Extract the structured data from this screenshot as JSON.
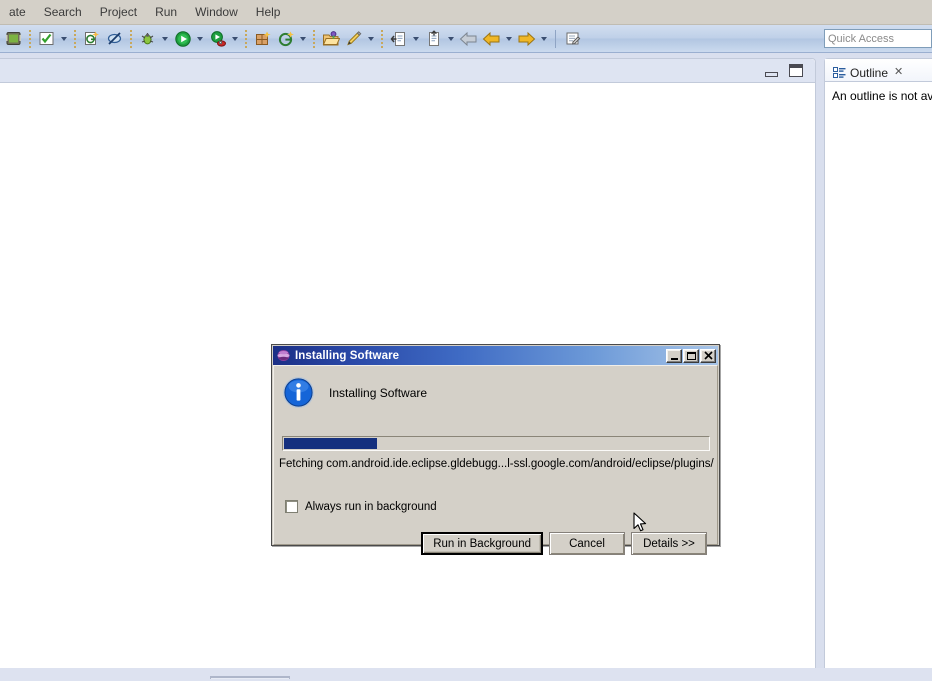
{
  "menubar": {
    "items": [
      {
        "label": "ate",
        "name": "menu-navigate"
      },
      {
        "label": "Search",
        "name": "menu-search"
      },
      {
        "label": "Project",
        "name": "menu-project"
      },
      {
        "label": "Run",
        "name": "menu-run"
      },
      {
        "label": "Window",
        "name": "menu-window"
      },
      {
        "label": "Help",
        "name": "menu-help"
      }
    ]
  },
  "toolbar": {
    "buttons": [
      {
        "name": "android-sdk-manager-icon",
        "title": "Android SDK Manager"
      },
      {
        "name": "save-check-icon",
        "title": "Save"
      },
      {
        "name": "new-java-class-icon",
        "title": "New Java Class"
      },
      {
        "name": "toggle-breakpoint-icon",
        "title": "Skip All Breakpoints"
      },
      {
        "name": "debug-icon",
        "title": "Debug"
      },
      {
        "name": "run-icon",
        "title": "Run"
      },
      {
        "name": "run-external-tools-icon",
        "title": "External Tools"
      },
      {
        "name": "new-package-icon",
        "title": "New Package"
      },
      {
        "name": "open-type-icon",
        "title": "Open Type"
      },
      {
        "name": "open-resource-icon",
        "title": "Open Resource"
      },
      {
        "name": "annotation-icon",
        "title": "Next Annotation"
      },
      {
        "name": "previous-edit-icon",
        "title": "Previous Edit Location"
      },
      {
        "name": "next-edit-icon",
        "title": "Next Edit Location"
      },
      {
        "name": "back-arrow-icon",
        "title": "Back"
      },
      {
        "name": "forward-arrow-icon",
        "title": "Forward"
      },
      {
        "name": "new-editor-icon",
        "title": "New Editor"
      }
    ]
  },
  "quick_access": {
    "placeholder": "Quick Access"
  },
  "editor_area": {
    "minimize_label": "Minimize",
    "maximize_label": "Maximize"
  },
  "outline": {
    "tab_label": "Outline",
    "close_label": "✕",
    "message": "An outline is not avai"
  },
  "dialog": {
    "title": "Installing Software",
    "heading": "Installing Software",
    "status_text": "Fetching com.android.ide.eclipse.gldebugg...l-ssl.google.com/android/eclipse/plugins/",
    "progress_percent": 22,
    "checkbox": {
      "label": "Always run in background",
      "checked": false
    },
    "buttons": {
      "run_in_background": "Run in Background",
      "cancel": "Cancel",
      "details": "Details >>"
    },
    "window_buttons": {
      "minimize": "_",
      "maximize": "□",
      "close": "✕"
    }
  },
  "colors": {
    "title_bar_start": "#1b2f86",
    "title_bar_end": "#a8c5e8",
    "progress_fill": "#15307e",
    "dialog_face": "#d4d0c8",
    "toolbar_blue": "#bfd0e8",
    "workbench_bg": "#d9dfee"
  }
}
